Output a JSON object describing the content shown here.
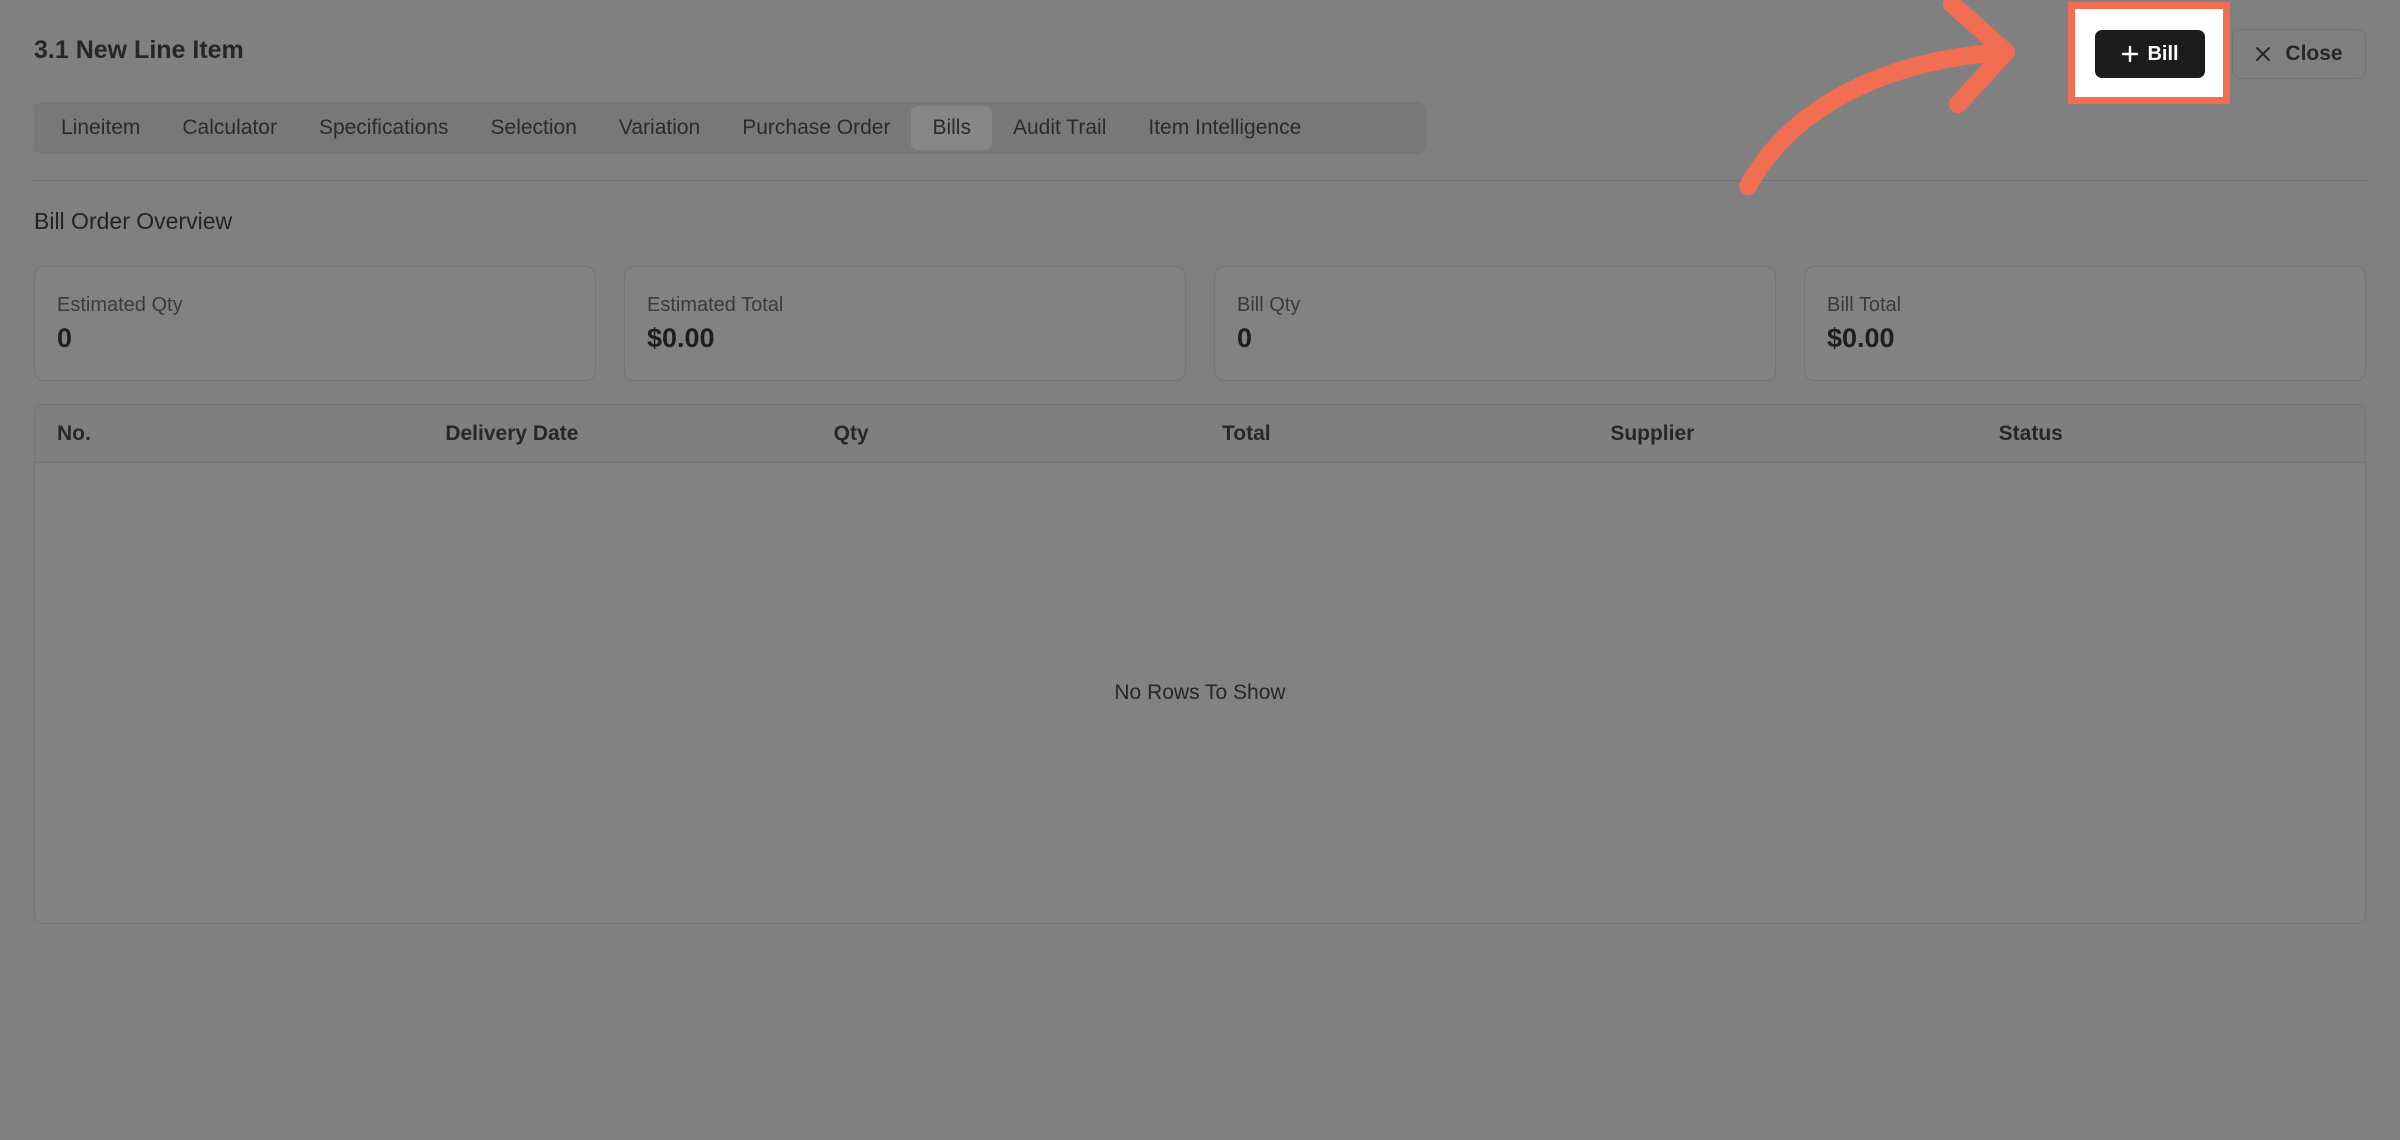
{
  "header": {
    "title": "3.1 New Line Item",
    "add_bill_label": "Bill",
    "close_label": "Close"
  },
  "tabs": [
    {
      "label": "Lineitem",
      "active": false
    },
    {
      "label": "Calculator",
      "active": false
    },
    {
      "label": "Specifications",
      "active": false
    },
    {
      "label": "Selection",
      "active": false
    },
    {
      "label": "Variation",
      "active": false
    },
    {
      "label": "Purchase Order",
      "active": false
    },
    {
      "label": "Bills",
      "active": true
    },
    {
      "label": "Audit Trail",
      "active": false
    },
    {
      "label": "Item Intelligence",
      "active": false
    }
  ],
  "overview": {
    "title": "Bill Order Overview",
    "cards": [
      {
        "label": "Estimated Qty",
        "value": "0"
      },
      {
        "label": "Estimated Total",
        "value": "$0.00"
      },
      {
        "label": "Bill Qty",
        "value": "0"
      },
      {
        "label": "Bill Total",
        "value": "$0.00"
      }
    ]
  },
  "table": {
    "columns": [
      "No.",
      "Delivery Date",
      "Qty",
      "Total",
      "Supplier",
      "Status"
    ],
    "empty_message": "No Rows To Show"
  },
  "icons": {
    "plus": "plus-icon",
    "close": "close-icon",
    "arrow": "annotation-arrow-icon"
  },
  "colors": {
    "highlight": "#f26e52",
    "primary_button": "#1c1c1c"
  }
}
